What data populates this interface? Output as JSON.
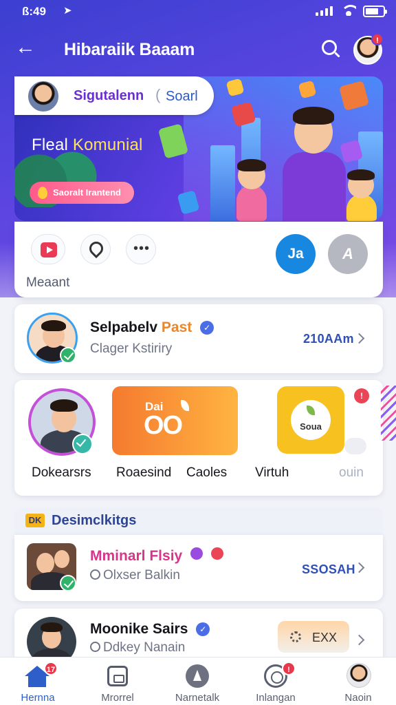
{
  "status_bar": {
    "time": "ß:49",
    "location_icon": "location-arrow-icon"
  },
  "app_bar": {
    "title": "Hibaraiik Baaam"
  },
  "banner": {
    "pill_title": "Sigutalenn",
    "pill_separator": "(",
    "pill_subtitle": "Soarl",
    "heading_part1": "Fleal",
    "heading_part2": "Komunial",
    "button_label": "Saoralt Irantend"
  },
  "actions": {
    "label": "Meaant",
    "blue_circle_text": "Ja",
    "gray_circle_text": "A"
  },
  "featured_row": {
    "title": "Selpabelv",
    "title_accent": "Past",
    "subtitle": "Clager Kstiriry",
    "meta": "210AAm"
  },
  "carousel": {
    "labels": [
      "Dokearsrs",
      "Roaesind",
      "Caoles",
      "Virtuh",
      "ouin"
    ],
    "orange_tile_top": "Dai",
    "orange_tile_main": "OO",
    "yellow_tile_text": "Soua",
    "badge": "!"
  },
  "section": {
    "icon_text": "DK",
    "title": "Desimclkitgs"
  },
  "rows": [
    {
      "title": "Mminarl Flsiy",
      "subtitle": "Olxser Balkin",
      "meta": "SSOSAH"
    },
    {
      "title": "Moonike Sairs",
      "subtitle": "Ddkey Nanain",
      "chip": "EXX"
    }
  ],
  "tab_bar": {
    "tabs": [
      {
        "label": "Hernna",
        "badge": "17"
      },
      {
        "label": "Mrorrel"
      },
      {
        "label": "Narnetalk"
      },
      {
        "label": "Inlangan",
        "badge": "!"
      },
      {
        "label": "Naoin"
      }
    ]
  },
  "colors": {
    "brand_blue": "#2e5ec9",
    "brand_purple": "#5a45e0",
    "accent_orange": "#e8872c"
  }
}
